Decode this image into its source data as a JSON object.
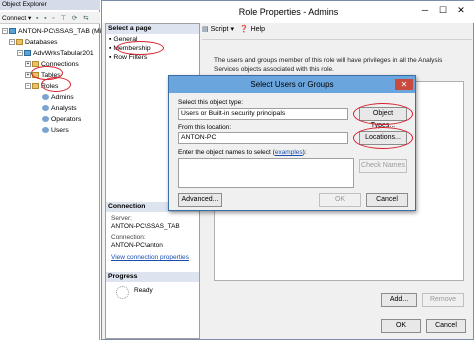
{
  "object_explorer": {
    "title": "Object Explorer",
    "connect_label": "Connect",
    "tree": {
      "server": "ANTON-PC\\SSAS_TAB (Mi",
      "databases": "Databases",
      "database": "AdvWrksTabular201",
      "connections": "Connections",
      "tables": "Tables",
      "roles": "Roles",
      "role_items": [
        "Admins",
        "Analysts",
        "Operators",
        "Users"
      ]
    }
  },
  "role_properties": {
    "title": "Role Properties - Admins",
    "select_page_header": "Select a page",
    "pages": [
      "General",
      "Membership",
      "Row Filters"
    ],
    "toolbar": {
      "script": "Script",
      "help": "Help"
    },
    "description": "The users and groups member of this role will have privileges in all the Analysis Services objects associated with this role.",
    "connection_header": "Connection",
    "server_label": "Server:",
    "server_value": "ANTON-PC\\SSAS_TAB",
    "connection_label": "Connection:",
    "connection_value": "ANTON-PC\\anton",
    "view_props_link": "View connection properties",
    "progress_header": "Progress",
    "progress_status": "Ready",
    "add_button": "Add...",
    "remove_button": "Remove",
    "ok_button": "OK",
    "cancel_button": "Cancel"
  },
  "dialog": {
    "title": "Select Users or Groups",
    "object_type_label": "Select this object type:",
    "object_type_value": "Users or Built-in security principals",
    "object_types_button": "Object Types...",
    "location_label": "From this location:",
    "location_value": "ANTON-PC",
    "locations_button": "Locations...",
    "names_label": "Enter the object names to select (",
    "examples_link": "examples",
    "names_label_end": "):",
    "check_names_button": "Check Names",
    "advanced_button": "Advanced...",
    "ok_button": "OK",
    "cancel_button": "Cancel"
  },
  "colors": {
    "annotation": "#d81e2c",
    "dialog_title": "#6aa5de"
  }
}
